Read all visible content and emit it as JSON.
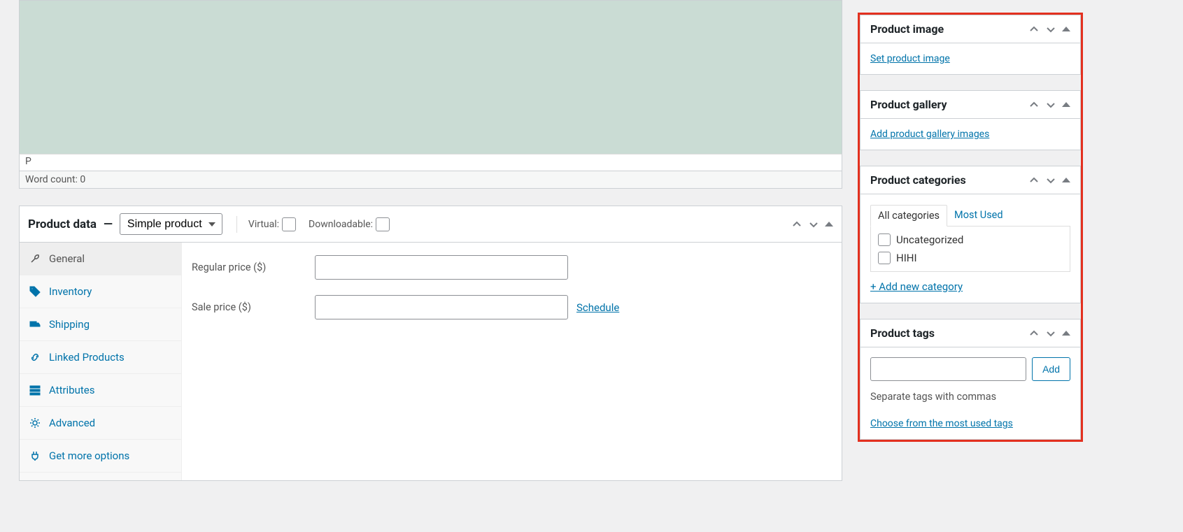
{
  "editor": {
    "path": "P",
    "word_count_label": "Word count: 0"
  },
  "product_data": {
    "title_prefix": "Product data",
    "title_sep": "—",
    "type_selected": "Simple product",
    "virtual_label": "Virtual:",
    "downloadable_label": "Downloadable:",
    "tabs": [
      {
        "label": "General"
      },
      {
        "label": "Inventory"
      },
      {
        "label": "Shipping"
      },
      {
        "label": "Linked Products"
      },
      {
        "label": "Attributes"
      },
      {
        "label": "Advanced"
      },
      {
        "label": "Get more options"
      }
    ],
    "regular_price_label": "Regular price ($)",
    "sale_price_label": "Sale price ($)",
    "schedule_label": "Schedule"
  },
  "side": {
    "image": {
      "title": "Product image",
      "link": "Set product image"
    },
    "gallery": {
      "title": "Product gallery",
      "link": "Add product gallery images"
    },
    "categories": {
      "title": "Product categories",
      "tab_all": "All categories",
      "tab_most": "Most Used",
      "items": [
        "Uncategorized",
        "HIHI"
      ],
      "add_label": "+ Add new category"
    },
    "tags": {
      "title": "Product tags",
      "add_btn": "Add",
      "hint": "Separate tags with commas",
      "choose": "Choose from the most used tags"
    }
  }
}
